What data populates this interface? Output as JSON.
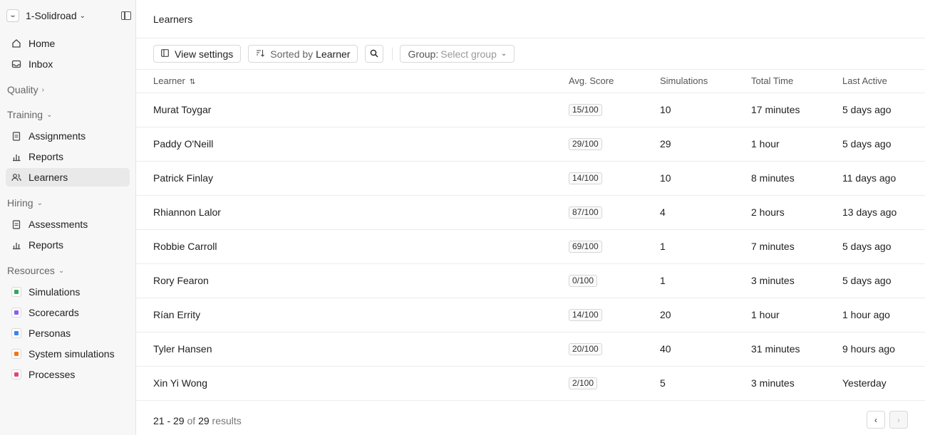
{
  "workspace": {
    "name": "1-Solidroad"
  },
  "sidebar": {
    "top_items": [
      {
        "label": "Home",
        "icon": "home-icon"
      },
      {
        "label": "Inbox",
        "icon": "inbox-icon"
      }
    ],
    "quality": {
      "label": "Quality"
    },
    "training": {
      "label": "Training",
      "items": [
        {
          "label": "Assignments",
          "icon": "clipboard-icon"
        },
        {
          "label": "Reports",
          "icon": "bar-chart-icon"
        },
        {
          "label": "Learners",
          "icon": "users-icon",
          "active": true
        }
      ]
    },
    "hiring": {
      "label": "Hiring",
      "items": [
        {
          "label": "Assessments",
          "icon": "clipboard-icon"
        },
        {
          "label": "Reports",
          "icon": "bar-chart-icon"
        }
      ]
    },
    "resources": {
      "label": "Resources",
      "items": [
        {
          "label": "Simulations",
          "icon": "headset-icon",
          "color": "#3aa55c"
        },
        {
          "label": "Scorecards",
          "icon": "scorecard-icon",
          "color": "#8b5cf6"
        },
        {
          "label": "Personas",
          "icon": "persona-icon",
          "color": "#3b82f6"
        },
        {
          "label": "System simulations",
          "icon": "system-icon",
          "color": "#f97316"
        },
        {
          "label": "Processes",
          "icon": "process-icon",
          "color": "#e0457b"
        }
      ]
    }
  },
  "page": {
    "title": "Learners"
  },
  "toolbar": {
    "view_settings": "View settings",
    "sorted_prefix": "Sorted by",
    "sorted_value": "Learner",
    "group_prefix": "Group:",
    "group_placeholder": "Select group"
  },
  "table": {
    "headers": {
      "learner": "Learner",
      "score": "Avg. Score",
      "simulations": "Simulations",
      "time": "Total Time",
      "active": "Last Active"
    },
    "rows": [
      {
        "name": "Murat Toygar",
        "score": "15/100",
        "simulations": "10",
        "time": "17 minutes",
        "active": "5 days ago"
      },
      {
        "name": "Paddy O'Neill",
        "score": "29/100",
        "simulations": "29",
        "time": "1 hour",
        "active": "5 days ago"
      },
      {
        "name": "Patrick Finlay",
        "score": "14/100",
        "simulations": "10",
        "time": "8 minutes",
        "active": "11 days ago"
      },
      {
        "name": "Rhiannon Lalor",
        "score": "87/100",
        "simulations": "4",
        "time": "2 hours",
        "active": "13 days ago"
      },
      {
        "name": "Robbie Carroll",
        "score": "69/100",
        "simulations": "1",
        "time": "7 minutes",
        "active": "5 days ago"
      },
      {
        "name": "Rory Fearon",
        "score": "0/100",
        "simulations": "1",
        "time": "3 minutes",
        "active": "5 days ago"
      },
      {
        "name": "Rían Errity",
        "score": "14/100",
        "simulations": "20",
        "time": "1 hour",
        "active": "1 hour ago"
      },
      {
        "name": "Tyler Hansen",
        "score": "20/100",
        "simulations": "40",
        "time": "31 minutes",
        "active": "9 hours ago"
      },
      {
        "name": "Xin Yi Wong",
        "score": "2/100",
        "simulations": "5",
        "time": "3 minutes",
        "active": "Yesterday"
      }
    ]
  },
  "pagination": {
    "range": "21 - 29",
    "of": "of",
    "total": "29",
    "suffix": "results"
  }
}
